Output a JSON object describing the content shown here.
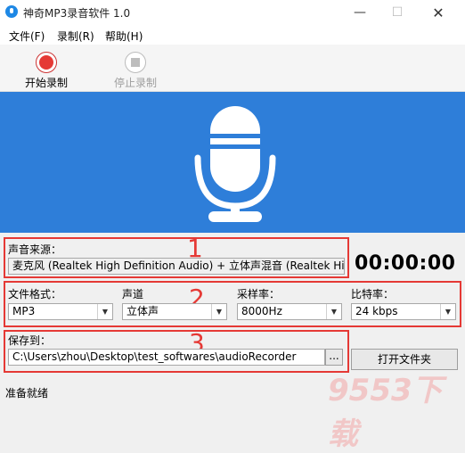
{
  "window": {
    "title": "神奇MP3录音软件 1.0",
    "min_glyph": "—",
    "max_glyph": "☐",
    "close_glyph": "✕"
  },
  "menu": {
    "items": [
      "文件(F)",
      "录制(R)",
      "帮助(H)"
    ]
  },
  "toolbar": {
    "start_label": "开始录制",
    "stop_label": "停止录制"
  },
  "source": {
    "label": "声音来源：",
    "value": "麦克风 (Realtek High Definition Audio) + 立体声混音 (Realtek Hig ..."
  },
  "timer": "00:00:00",
  "format": {
    "label": "文件格式：",
    "value": "MP3"
  },
  "channel": {
    "label": "声道",
    "value": "立体声"
  },
  "samplerate": {
    "label": "采样率：",
    "value": "8000Hz"
  },
  "bitrate": {
    "label": "比特率：",
    "value": "24 kbps"
  },
  "save": {
    "label": "保存到：",
    "path": "C:\\Users\\zhou\\Desktop\\test_softwares\\audioRecorder",
    "browse_label": "...",
    "open_folder_label": "打开文件夹"
  },
  "annotations": [
    "1",
    "2",
    "3"
  ],
  "status": "准备就绪",
  "watermark": "9553下载",
  "colors": {
    "banner": "#2e7ed9",
    "highlight": "#e53935",
    "record": "#e53935"
  }
}
